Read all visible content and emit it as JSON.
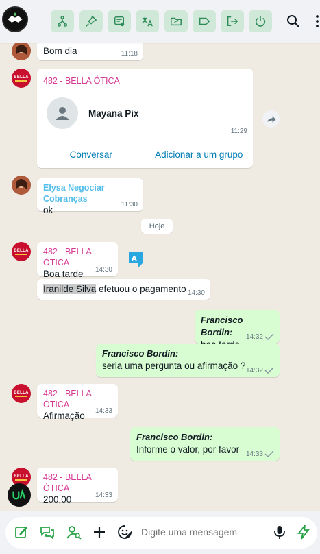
{
  "toolbar": {
    "logo": "team-handshake-logo",
    "buttons": [
      "transfer-icon",
      "pin-icon",
      "note-icon",
      "translate-icon",
      "folder-share-icon",
      "tag-icon",
      "exit-icon",
      "power-icon"
    ],
    "accent": "#cfe8d8"
  },
  "messages": [
    {
      "text": "Bom dia",
      "time": "11:18"
    },
    {
      "sender": "482 - BELLA ÓTICA",
      "contact_name": "Mayana Pix",
      "time": "11:29",
      "action_chat": "Conversar",
      "action_group": "Adicionar a um grupo"
    },
    {
      "sender": "Elysa Negociar Cobranças",
      "text": "ok",
      "time": "11:30"
    },
    {
      "sender": "482 - BELLA ÓTICA",
      "text": "Boa tarde",
      "time": "14:30"
    },
    {
      "highlight": "Iranilde Silva",
      "text": " efetuou o pagamento",
      "time": "14:30"
    },
    {
      "author": "Francisco Bordin:",
      "text": "boa tarde",
      "time": "14:32"
    },
    {
      "author": "Francisco Bordin:",
      "text": "seria uma pergunta ou afirmação ?",
      "time": "14:32"
    },
    {
      "sender": "482 - BELLA ÓTICA",
      "text": "Afirmação",
      "time": "14:33"
    },
    {
      "author": "Francisco Bordin:",
      "text": "Informe o valor, por favor",
      "time": "14:33"
    },
    {
      "sender": "482 - BELLA ÓTICA",
      "text": "200,00",
      "time": "14:33"
    }
  ],
  "date_divider": "Hoje",
  "avatar_brand": "BELLA",
  "composer": {
    "placeholder": "Digite uma mensagem"
  },
  "colors": {
    "outgoing": "#d9fdd3",
    "sender_pink": "#d63a95",
    "sender_blue": "#53bdeb",
    "link": "#027eb5",
    "brand_green": "#25a244"
  }
}
